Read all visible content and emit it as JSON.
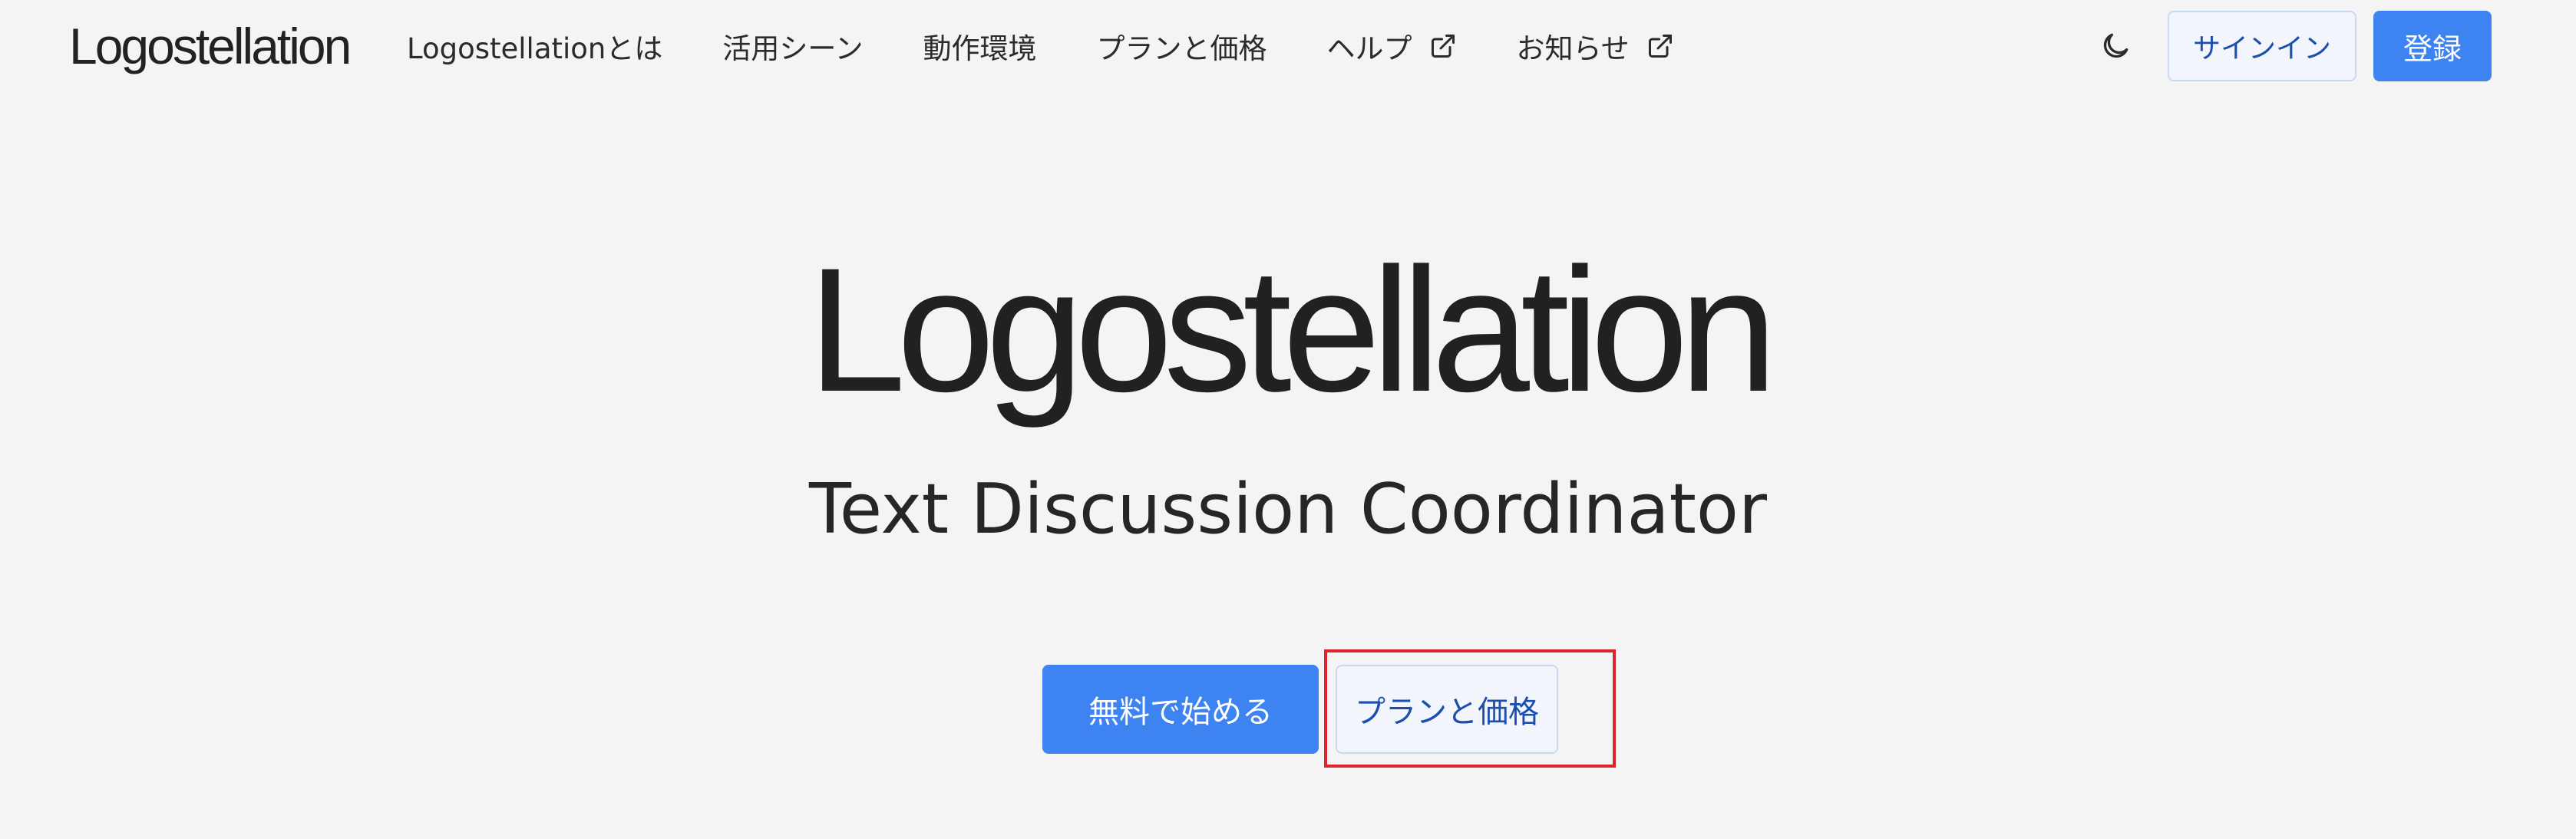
{
  "header": {
    "brand": "Logostellation",
    "nav": [
      {
        "label": "Logostellationとは",
        "external": false
      },
      {
        "label": "活用シーン",
        "external": false
      },
      {
        "label": "動作環境",
        "external": false
      },
      {
        "label": "プランと価格",
        "external": false
      },
      {
        "label": "ヘルプ",
        "external": true,
        "icon": "external-link-icon"
      },
      {
        "label": "お知らせ",
        "external": true,
        "icon": "external-link-icon"
      }
    ],
    "theme_icon": "moon-icon",
    "signin_label": "サインイン",
    "register_label": "登録"
  },
  "hero": {
    "title": "Logostellation",
    "subtitle": "Text Discussion Coordinator",
    "start_label": "無料で始める",
    "pricing_label": "プランと価格"
  },
  "colors": {
    "primary": "#3d84f2",
    "outline_text": "#1c4fad",
    "highlight": "#e0222e",
    "background": "#f4f4f4"
  }
}
